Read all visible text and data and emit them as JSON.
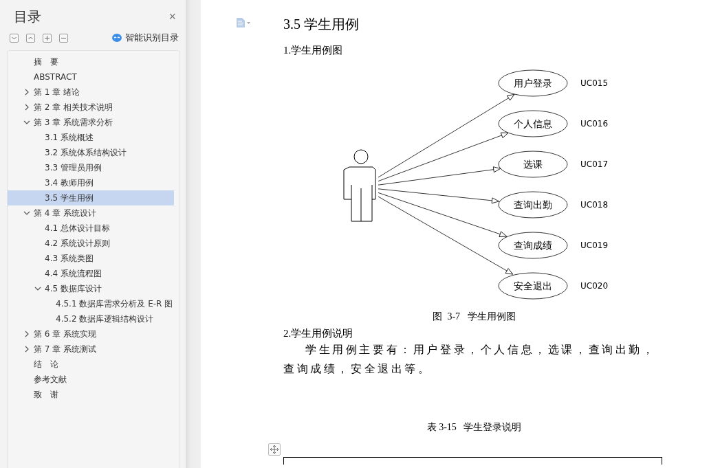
{
  "sidebar": {
    "title": "目录",
    "close": "×",
    "smart_toc_label": "智能识别目录",
    "tree": [
      {
        "label": "摘　要",
        "kind": "leaf",
        "selected": false
      },
      {
        "label": "ABSTRACT",
        "kind": "leaf",
        "selected": false
      },
      {
        "label": "第 1 章  绪论",
        "kind": "node",
        "expanded": false,
        "selected": false
      },
      {
        "label": "第 2 章  相关技术说明",
        "kind": "node",
        "expanded": false,
        "selected": false
      },
      {
        "label": "第 3 章  系统需求分析",
        "kind": "node",
        "expanded": true,
        "selected": false,
        "children": [
          {
            "label": "3.1 系统概述",
            "kind": "leaf",
            "selected": false
          },
          {
            "label": "3.2 系统体系结构设计",
            "kind": "leaf",
            "selected": false
          },
          {
            "label": "3.3 管理员用例",
            "kind": "leaf",
            "selected": false
          },
          {
            "label": "3.4 教师用例",
            "kind": "leaf",
            "selected": false
          },
          {
            "label": "3.5 学生用例",
            "kind": "leaf",
            "selected": true
          }
        ]
      },
      {
        "label": "第 4 章  系统设计",
        "kind": "node",
        "expanded": true,
        "selected": false,
        "children": [
          {
            "label": "4.1 总体设计目标",
            "kind": "leaf",
            "selected": false
          },
          {
            "label": "4.2 系统设计原则",
            "kind": "leaf",
            "selected": false
          },
          {
            "label": "4.3 系统类图",
            "kind": "leaf",
            "selected": false
          },
          {
            "label": "4.4 系统流程图",
            "kind": "leaf",
            "selected": false
          },
          {
            "label": "4.5 数据库设计",
            "kind": "node",
            "expanded": true,
            "selected": false,
            "children": [
              {
                "label": "4.5.1 数据库需求分析及 E-R 图",
                "kind": "leaf",
                "selected": false
              },
              {
                "label": "4.5.2  数据库逻辑结构设计",
                "kind": "leaf",
                "selected": false
              }
            ]
          }
        ]
      },
      {
        "label": "第 6 章  系统实现",
        "kind": "node",
        "expanded": false,
        "selected": false
      },
      {
        "label": "第 7 章  系统测试",
        "kind": "node",
        "expanded": false,
        "selected": false
      },
      {
        "label": "结　论",
        "kind": "leaf",
        "selected": false
      },
      {
        "label": "参考文献",
        "kind": "leaf",
        "selected": false
      },
      {
        "label": "致　谢",
        "kind": "leaf",
        "selected": false
      }
    ]
  },
  "document": {
    "heading": "3.5 学生用例",
    "subheading_1": "1.学生用例图",
    "diagram": {
      "use_cases": [
        {
          "name": "用户登录",
          "id": "UC015"
        },
        {
          "name": "个人信息",
          "id": "UC016"
        },
        {
          "name": "选课",
          "id": "UC017"
        },
        {
          "name": "查询出勤",
          "id": "UC018"
        },
        {
          "name": "查询成绩",
          "id": "UC019"
        },
        {
          "name": "安全退出",
          "id": "UC020"
        }
      ]
    },
    "figure_caption": "图  3-7   学生用例图",
    "subheading_2": "2.学生用例说明",
    "paragraph": "学生用例主要有：用户登录，个人信息，选课，查询出勤，查询成绩，安全退出等。",
    "table_caption": "表 3-15   学生登录说明"
  }
}
